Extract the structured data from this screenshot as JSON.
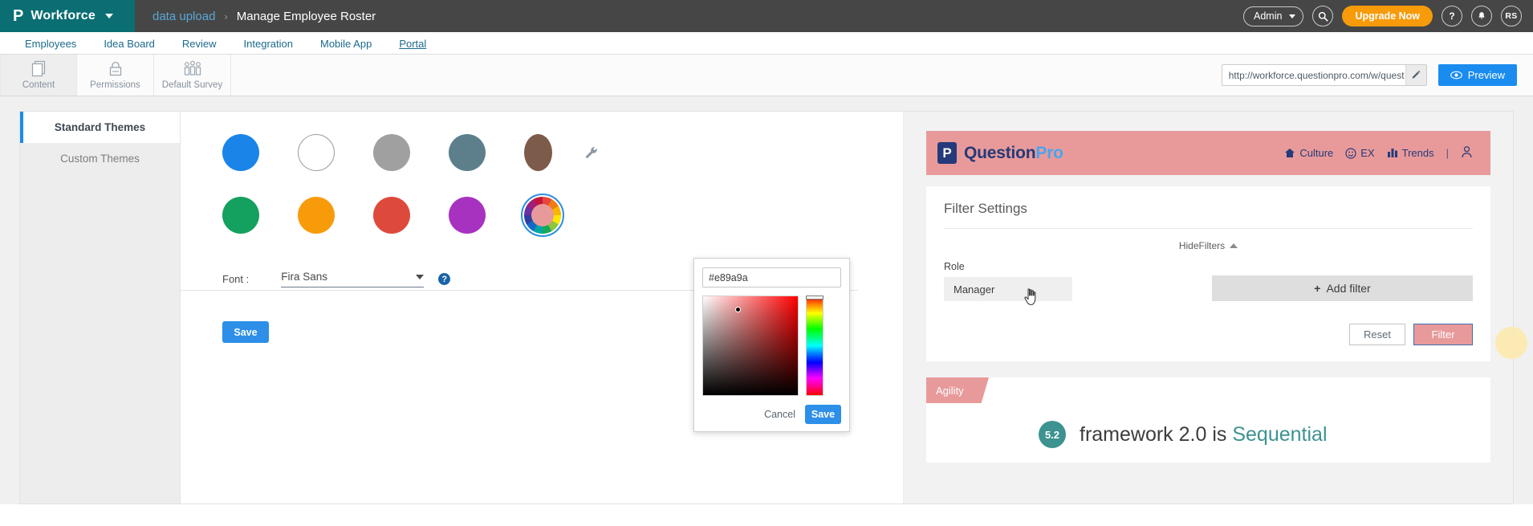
{
  "header": {
    "logo_glyph": "P",
    "brand": "Workforce",
    "breadcrumb_link": "data upload",
    "breadcrumb_sep": "›",
    "breadcrumb_current": "Manage Employee Roster",
    "admin_label": "Admin",
    "upgrade_label": "Upgrade Now",
    "help_label": "?",
    "avatar_initials": "RS"
  },
  "nav": {
    "tabs": [
      {
        "label": "Employees",
        "active": false
      },
      {
        "label": "Idea Board",
        "active": false
      },
      {
        "label": "Review",
        "active": false
      },
      {
        "label": "Integration",
        "active": false
      },
      {
        "label": "Mobile App",
        "active": false
      },
      {
        "label": "Portal",
        "active": true
      }
    ]
  },
  "toolbar": {
    "items": [
      {
        "label": "Content",
        "icon": "pages-icon",
        "active": true
      },
      {
        "label": "Permissions",
        "icon": "lock-icon",
        "active": false
      },
      {
        "label": "Default Survey",
        "icon": "people-icon",
        "active": false
      }
    ],
    "url_value": "http://workforce.questionpro.com/w/quest",
    "edit_icon": "pencil-icon",
    "preview_label": "Preview",
    "preview_icon": "eye-icon"
  },
  "themes": {
    "tabs": [
      {
        "label": "Standard Themes",
        "active": true
      },
      {
        "label": "Custom Themes",
        "active": false
      }
    ],
    "swatches": [
      {
        "name": "blue",
        "color": "#1a84e8"
      },
      {
        "name": "white",
        "color": "#ffffff"
      },
      {
        "name": "gray",
        "color": "#a0a0a0"
      },
      {
        "name": "slate",
        "color": "#5d7f8c"
      },
      {
        "name": "brown",
        "color": "#7d5b4a"
      },
      {
        "name": "green",
        "color": "#14a05e"
      },
      {
        "name": "orange",
        "color": "#f89b0b"
      },
      {
        "name": "red",
        "color": "#dd4a3c"
      },
      {
        "name": "purple",
        "color": "#a832c0"
      }
    ],
    "wrench_icon": "wrench-icon",
    "custom_wheel_name": "color-wheel-swatch",
    "font_label": "Font :",
    "font_value": "Fira Sans",
    "help_icon": "?",
    "save_label": "Save"
  },
  "color_picker": {
    "hex_value": "#e89a9a",
    "cancel_label": "Cancel",
    "save_label": "Save"
  },
  "preview": {
    "logo_glyph": "P",
    "brand_first": "Question",
    "brand_second": "Pro",
    "nav": [
      {
        "label": "Culture",
        "icon": "home-icon"
      },
      {
        "label": "EX",
        "icon": "smiley-icon"
      },
      {
        "label": "Trends",
        "icon": "bars-icon"
      }
    ],
    "nav_separator": "|",
    "account_icon": "user-icon",
    "filter_card": {
      "title": "Filter Settings",
      "hide_filters_label": "HideFilters",
      "collapse_icon": "chevron-up-icon",
      "role_label": "Role",
      "role_value": "Manager",
      "add_filter_label": "Add filter",
      "add_filter_icon": "plus-icon",
      "reset_label": "Reset",
      "filter_label": "Filter"
    },
    "result_card": {
      "tag_label": "Agility",
      "score": "5.2",
      "statement_prefix": "framework 2.0 is ",
      "statement_highlight": "Sequential"
    },
    "accent_color": "#e89a9a",
    "score_color": "#3d9390"
  }
}
